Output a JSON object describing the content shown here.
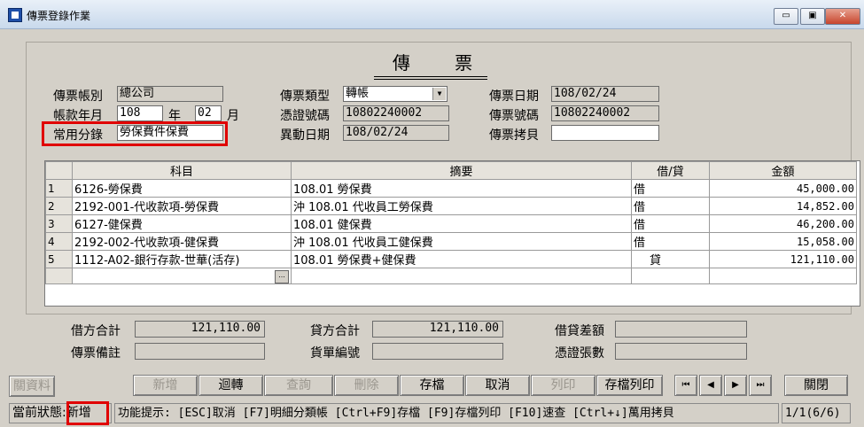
{
  "window": {
    "title": "傳票登錄作業",
    "btn_min": "▭",
    "btn_max": "▣",
    "btn_close": "✕"
  },
  "heading": "傳 票",
  "header": {
    "account_type_label": "傳票帳別",
    "account_type_value": "總公司",
    "period_label": "帳款年月",
    "year_value": "108",
    "year_unit": "年",
    "month_value": "02",
    "month_unit": "月",
    "common_entry_label": "常用分錄",
    "common_entry_value": "勞保費件保費",
    "voucher_type_label": "傳票類型",
    "voucher_type_value": "轉帳",
    "cert_no_label": "憑證號碼",
    "cert_no_value": "10802240002",
    "change_date_label": "異動日期",
    "change_date_value": "108/02/24",
    "voucher_date_label": "傳票日期",
    "voucher_date_value": "108/02/24",
    "voucher_no_label": "傳票號碼",
    "voucher_no_value": "10802240002",
    "copy_label": "傳票拷貝",
    "copy_value": ""
  },
  "grid": {
    "headers": [
      "科目",
      "摘要",
      "借/貸",
      "金額"
    ],
    "rows": [
      {
        "n": "1",
        "account": "6126-勞保費",
        "memo": "108.01 勞保費",
        "dc": "借",
        "amount": "45,000.00"
      },
      {
        "n": "2",
        "account": "2192-001-代收款項-勞保費",
        "memo": "沖 108.01 代收員工勞保費",
        "dc": "借",
        "amount": "14,852.00"
      },
      {
        "n": "3",
        "account": "6127-健保費",
        "memo": "108.01 健保費",
        "dc": "借",
        "amount": "46,200.00"
      },
      {
        "n": "4",
        "account": "2192-002-代收款項-健保費",
        "memo": "沖 108.01 代收員工健保費",
        "dc": "借",
        "amount": "15,058.00"
      },
      {
        "n": "5",
        "account": "1112-A02-銀行存款-世華(活存)",
        "memo": "108.01 勞保費+健保費",
        "dc": "貸",
        "amount": "121,110.00"
      }
    ],
    "ellipsis": "..."
  },
  "totals": {
    "debit_label": "借方合計",
    "debit_value": "121,110.00",
    "credit_label": "貸方合計",
    "credit_value": "121,110.00",
    "diff_label": "借貸差額",
    "diff_value": "",
    "note_label": "傳票備註",
    "note_value": "",
    "doc_no_label": "貨單編號",
    "doc_no_value": "",
    "cert_count_label": "憑證張數",
    "cert_count_value": ""
  },
  "buttons": {
    "close_data": "關資料",
    "new": "新增",
    "revert": "迴轉",
    "query": "查詢",
    "delete": "刪除",
    "save": "存檔",
    "cancel": "取消",
    "print": "列印",
    "save_print": "存檔列印",
    "first": "⏮",
    "prev": "◀",
    "next": "▶",
    "last": "⏭",
    "close": "關閉"
  },
  "status": {
    "state_label": "當前狀態:",
    "state_value": "新增",
    "hint": "功能提示: [ESC]取消 [F7]明細分類帳 [Ctrl+F9]存檔 [F9]存檔列印 [F10]速查 [Ctrl+↓]萬用拷貝",
    "page": "1/1(6/6)"
  }
}
